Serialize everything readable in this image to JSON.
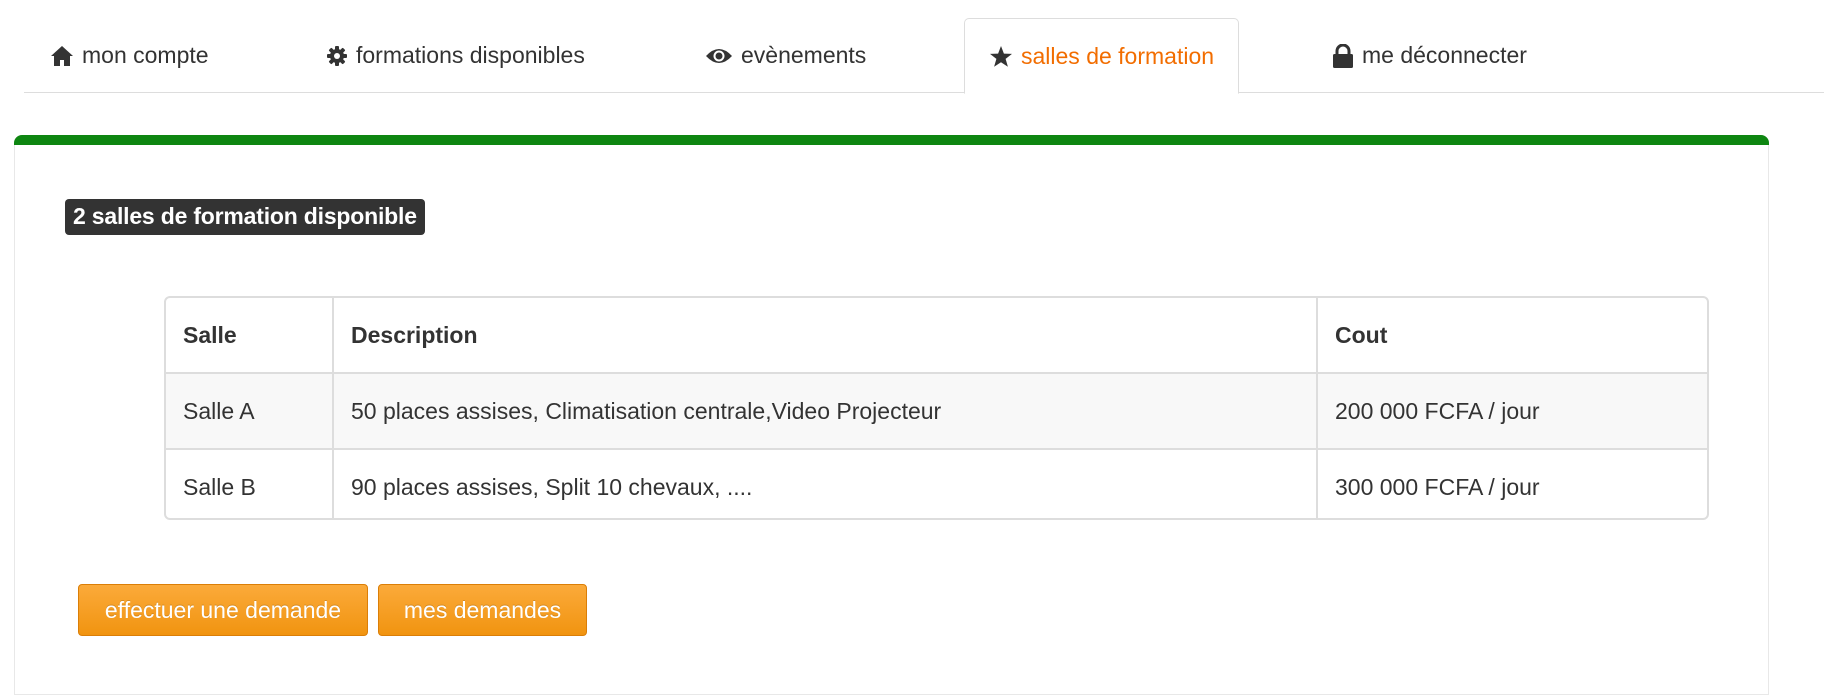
{
  "tabs": [
    {
      "label": "mon compte",
      "icon": "home-icon",
      "active": false
    },
    {
      "label": "formations disponibles",
      "icon": "gear-icon",
      "active": false
    },
    {
      "label": "evènements",
      "icon": "eye-icon",
      "active": false
    },
    {
      "label": "salles de formation",
      "icon": "star-icon",
      "active": true
    },
    {
      "label": "me déconnecter",
      "icon": "lock-icon",
      "active": false
    }
  ],
  "colors": {
    "accent": "#f26d00",
    "panel_bar": "#0e8611",
    "badge_bg": "#333333",
    "button": "#f5a12a"
  },
  "main": {
    "count_badge": "2 salles de formation disponible",
    "table": {
      "headers": [
        "Salle",
        "Description",
        "Cout"
      ],
      "rows": [
        [
          "Salle A",
          "50 places assises, Climatisation centrale,Video Projecteur",
          "200 000 FCFA / jour"
        ],
        [
          "Salle B",
          "90 places assises, Split 10 chevaux, ....",
          "300 000 FCFA / jour"
        ]
      ]
    },
    "buttons": {
      "request": "effectuer une demande",
      "my_requests": "mes demandes"
    }
  }
}
